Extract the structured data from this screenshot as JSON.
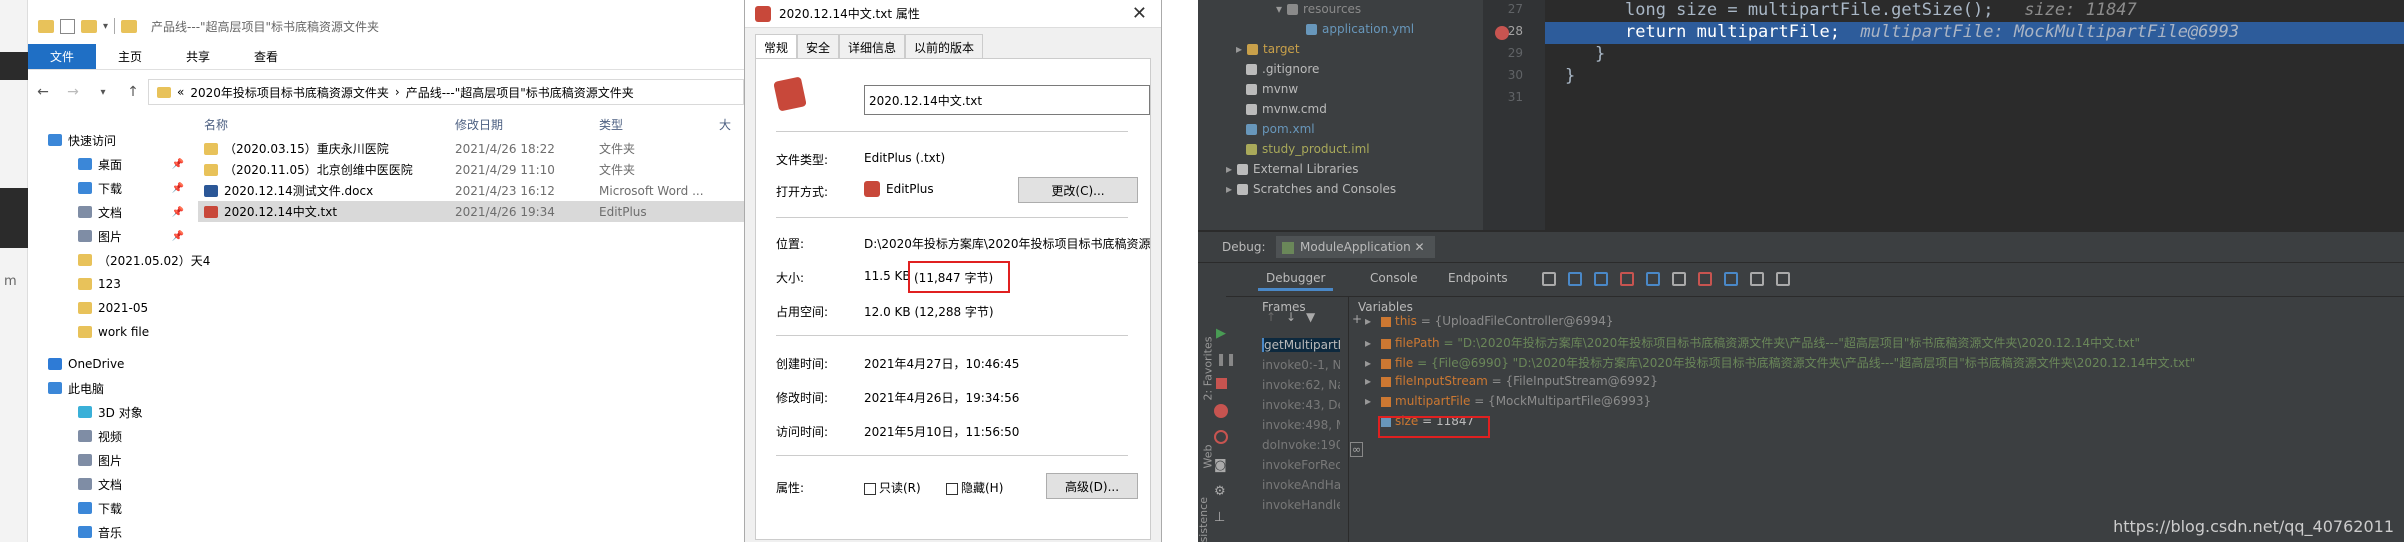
{
  "explorer": {
    "title": "产品线---\"超高层项目\"标书底稿资源文件夹",
    "ribbon": [
      "文件",
      "主页",
      "共享",
      "查看"
    ],
    "path": [
      "«",
      "2020年投标项目标书底稿资源文件夹",
      "›",
      "产品线---\"超高层项目\"标书底稿资源文件夹"
    ],
    "nav": [
      {
        "label": "快速访问",
        "color": "#3b87d8",
        "pin": false
      },
      {
        "label": "桌面",
        "color": "#3b87d8",
        "pin": true
      },
      {
        "label": "下载",
        "color": "#3b87d8",
        "pin": true
      },
      {
        "label": "文档",
        "color": "#7f8da5",
        "pin": true
      },
      {
        "label": "图片",
        "color": "#7f8da5",
        "pin": true
      },
      {
        "label": "（2021.05.02）天4",
        "color": "#e8c25a",
        "pin": false
      },
      {
        "label": "123",
        "color": "#e8c25a",
        "pin": false
      },
      {
        "label": "2021-05",
        "color": "#e8c25a",
        "pin": false
      },
      {
        "label": "work file",
        "color": "#e8c25a",
        "pin": false
      },
      {
        "label": "OneDrive",
        "color": "#2e7bd6",
        "pin": false
      },
      {
        "label": "此电脑",
        "color": "#3b87d8",
        "pin": false
      },
      {
        "label": "3D 对象",
        "color": "#3ab0d8",
        "pin": false
      },
      {
        "label": "视频",
        "color": "#7f8da5",
        "pin": false
      },
      {
        "label": "图片",
        "color": "#7f8da5",
        "pin": false
      },
      {
        "label": "文档",
        "color": "#7f8da5",
        "pin": false
      },
      {
        "label": "下载",
        "color": "#3b87d8",
        "pin": false
      },
      {
        "label": "音乐",
        "color": "#3b87d8",
        "pin": false
      }
    ],
    "columns": [
      "名称",
      "修改日期",
      "类型",
      "大"
    ],
    "files": [
      {
        "name": "（2020.03.15）重庆永川医院",
        "date": "2021/4/26 18:22",
        "type": "文件夹",
        "color": "#e8c25a"
      },
      {
        "name": "（2020.11.05）北京创维中医医院",
        "date": "2021/4/29 11:10",
        "type": "文件夹",
        "color": "#e8c25a"
      },
      {
        "name": "2020.12.14测试文件.docx",
        "date": "2021/4/23 16:12",
        "type": "Microsoft Word ...",
        "color": "#2b5797"
      },
      {
        "name": "2020.12.14中文.txt",
        "date": "2021/4/26 19:34",
        "type": "EditPlus",
        "color": "#c8483a"
      }
    ]
  },
  "dialog": {
    "title": "2020.12.14中文.txt 属性",
    "tabs": [
      "常规",
      "安全",
      "详细信息",
      "以前的版本"
    ],
    "filename": "2020.12.14中文.txt",
    "filetype_label": "文件类型:",
    "filetype": "EditPlus (.txt)",
    "openwith_label": "打开方式:",
    "openwith": "EditPlus",
    "change_btn": "更改(C)...",
    "location_label": "位置:",
    "location": "D:\\2020年投标方案库\\2020年投标项目标书底稿资源",
    "size_label": "大小:",
    "size": "11.5 KB",
    "size_bytes": "(11,847 字节)",
    "disk_label": "占用空间:",
    "disk": "12.0 KB (12,288 字节)",
    "created_label": "创建时间:",
    "created": "2021年4月27日，10:46:45",
    "modified_label": "修改时间:",
    "modified": "2021年4月26日，19:34:56",
    "accessed_label": "访问时间:",
    "accessed": "2021年5月10日，11:56:50",
    "attr_label": "属性:",
    "readonly": "只读(R)",
    "hidden": "隐藏(H)",
    "advanced_btn": "高级(D)..."
  },
  "ide": {
    "tree": [
      {
        "label": "resources",
        "indent": 70,
        "color": "#8a8a8a",
        "arrow": "▾"
      },
      {
        "label": "application.yml",
        "indent": 100,
        "color": "#6897bb",
        "arrow": ""
      },
      {
        "label": "target",
        "indent": 30,
        "color": "#c8a04a",
        "arrow": "▸"
      },
      {
        "label": ".gitignore",
        "indent": 40,
        "color": "#bbbbbb",
        "arrow": ""
      },
      {
        "label": "mvnw",
        "indent": 40,
        "color": "#bbbbbb",
        "arrow": ""
      },
      {
        "label": "mvnw.cmd",
        "indent": 40,
        "color": "#bbbbbb",
        "arrow": ""
      },
      {
        "label": "pom.xml",
        "indent": 40,
        "color": "#6897bb",
        "arrow": ""
      },
      {
        "label": "study_product.iml",
        "indent": 40,
        "color": "#a9a95a",
        "arrow": ""
      },
      {
        "label": "External Libraries",
        "indent": 20,
        "color": "#bbbbbb",
        "arrow": "▸"
      },
      {
        "label": "Scratches and Consoles",
        "indent": 20,
        "color": "#bbbbbb",
        "arrow": "▸"
      }
    ],
    "line_numbers": [
      "27",
      "28",
      "29",
      "30",
      "31"
    ],
    "code": {
      "line27": "long size = multipartFile.getSize();",
      "line27_hint": "size: 11847",
      "line28": "return multipartFile;",
      "line28_hint": "multipartFile: MockMultipartFile@6993",
      "line29": "}",
      "line30": "}"
    },
    "debug_label": "Debug:",
    "debug_app": "ModuleApplication",
    "debug_tabs": [
      "Debugger",
      "Console",
      "Endpoints"
    ],
    "frames_label": "Frames",
    "variables_label": "Variables",
    "frames": [
      "getMultipartF",
      "invoke0:-1, N",
      "invoke:62, Na",
      "invoke:43, De",
      "invoke:498, M",
      "doInvoke:190",
      "invokeForRec",
      "invokeAndHa",
      "invokeHandle"
    ],
    "variables": [
      {
        "name": "this",
        "value": "= {UploadFileController@6994}",
        "arrow": "▸",
        "icon": "#cc7832"
      },
      {
        "name": "filePath",
        "value": "= \"D:\\2020年投标方案库\\2020年投标项目标书底稿资源文件夹\\产品线---\"超高层项目\"标书底稿资源文件夹\\2020.12.14中文.txt\"",
        "arrow": "▸",
        "icon": "#cc7832"
      },
      {
        "name": "file",
        "value": "= {File@6990} \"D:\\2020年投标方案库\\2020年投标项目标书底稿资源文件夹\\产品线---\"超高层项目\"标书底稿资源文件夹\\2020.12.14中文.txt\"",
        "arrow": "▸",
        "icon": "#cc7832"
      },
      {
        "name": "fileInputStream",
        "value": "= {FileInputStream@6992}",
        "arrow": "▸",
        "icon": "#cc7832"
      },
      {
        "name": "multipartFile",
        "value": "= {MockMultipartFile@6993}",
        "arrow": "▸",
        "icon": "#cc7832"
      },
      {
        "name": "size",
        "value": "= 11847",
        "arrow": "",
        "icon": "#6897bb"
      }
    ],
    "side_labels": [
      "2: Favorites",
      "Web",
      "Persistence"
    ],
    "watermark": "https://blog.csdn.net/qq_40762011"
  },
  "edge": {
    "mark": "m"
  }
}
